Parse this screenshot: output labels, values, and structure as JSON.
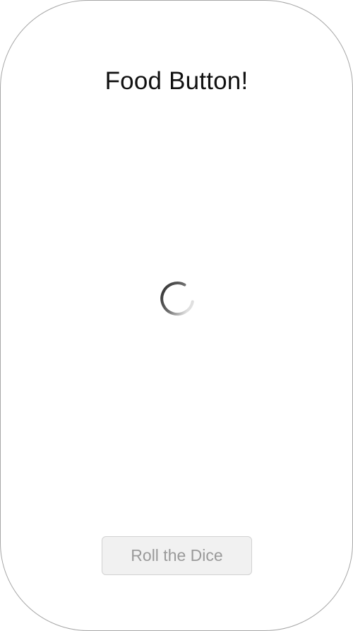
{
  "app": {
    "title": "Food Button!"
  },
  "loading": {
    "indicator": "spinner-icon",
    "active": true
  },
  "actions": {
    "roll_label": "Roll the Dice",
    "roll_enabled": false
  },
  "colors": {
    "frame_border": "#a7a7a7",
    "title_text": "#111111",
    "button_background": "#f1f1f1",
    "button_border": "#d2d2d2",
    "button_text": "#9a9a9a",
    "spinner_dark": "#2a2a2a",
    "spinner_light": "#e0e0e0"
  }
}
